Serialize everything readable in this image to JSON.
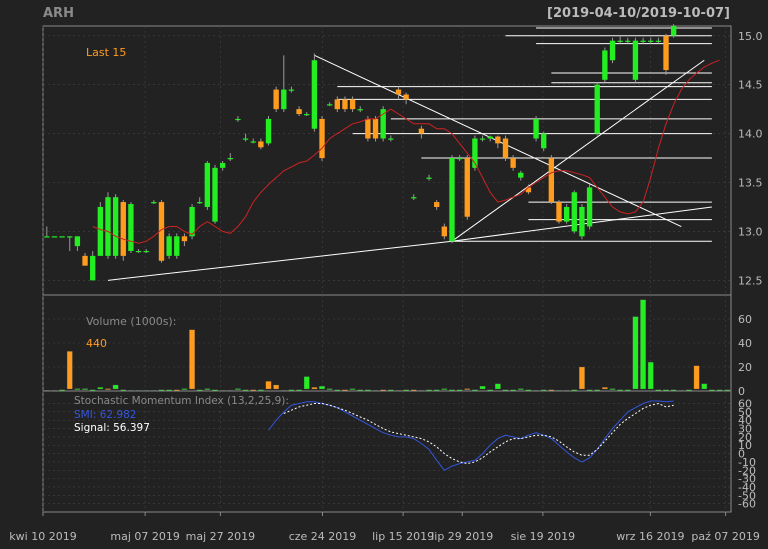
{
  "header": {
    "symbol": "ARH",
    "range": "[2019-04-10/2019-10-07]"
  },
  "colors": {
    "up": "#22ee22",
    "down": "#ff9c1e",
    "ma": "#cc2222",
    "smi": "#3355dd",
    "signal": "#ffffff",
    "panel": "#222222",
    "grid": "#444444"
  },
  "chart_data": [
    {
      "type": "candlestick",
      "panel": "price",
      "label": "Last 15",
      "ylim": [
        12.35,
        15.1
      ],
      "y_ticks": [
        12.5,
        13.0,
        13.5,
        14.0,
        14.5,
        15.0
      ],
      "y_tick_labels": [
        "12.5",
        "13.0",
        "13.5",
        "14.0",
        "14.5",
        "15.0"
      ],
      "candles": [
        {
          "o": 12.95,
          "c": 12.95,
          "h": 13.05,
          "l": 12.95
        },
        {
          "o": 12.95,
          "c": 12.95,
          "h": 12.95,
          "l": 12.95
        },
        {
          "o": 12.95,
          "c": 12.95,
          "h": 12.95,
          "l": 12.95
        },
        {
          "o": 12.95,
          "c": 12.95,
          "h": 12.95,
          "l": 12.8
        },
        {
          "o": 12.85,
          "c": 12.95,
          "h": 12.95,
          "l": 12.8
        },
        {
          "o": 12.75,
          "c": 12.65,
          "h": 12.78,
          "l": 12.65
        },
        {
          "o": 12.5,
          "c": 12.75,
          "h": 12.8,
          "l": 12.5
        },
        {
          "o": 12.75,
          "c": 13.25,
          "h": 13.3,
          "l": 12.75
        },
        {
          "o": 12.75,
          "c": 13.35,
          "h": 13.4,
          "l": 12.72
        },
        {
          "o": 12.75,
          "c": 13.35,
          "h": 13.38,
          "l": 12.72
        },
        {
          "o": 13.3,
          "c": 12.75,
          "h": 13.32,
          "l": 12.7
        },
        {
          "o": 12.8,
          "c": 13.28,
          "h": 13.3,
          "l": 12.78
        },
        {
          "o": 12.8,
          "c": 12.8,
          "h": 12.82,
          "l": 12.78
        },
        {
          "o": 12.8,
          "c": 12.8,
          "h": 12.82,
          "l": 12.78
        },
        {
          "o": 13.3,
          "c": 13.3,
          "h": 13.32,
          "l": 13.28
        },
        {
          "o": 13.3,
          "c": 12.7,
          "h": 13.32,
          "l": 12.68
        },
        {
          "o": 12.75,
          "c": 12.95,
          "h": 12.98,
          "l": 12.72
        },
        {
          "o": 12.75,
          "c": 12.95,
          "h": 12.98,
          "l": 12.72
        },
        {
          "o": 12.95,
          "c": 12.9,
          "h": 12.98,
          "l": 12.85
        },
        {
          "o": 12.95,
          "c": 13.25,
          "h": 13.28,
          "l": 12.92
        },
        {
          "o": 13.3,
          "c": 13.3,
          "h": 13.35,
          "l": 13.28
        },
        {
          "o": 13.25,
          "c": 13.7,
          "h": 13.72,
          "l": 13.22
        },
        {
          "o": 13.1,
          "c": 13.65,
          "h": 13.68,
          "l": 13.08
        },
        {
          "o": 13.65,
          "c": 13.7,
          "h": 13.72,
          "l": 13.62
        },
        {
          "o": 13.75,
          "c": 13.75,
          "h": 13.8,
          "l": 13.72
        },
        {
          "o": 14.15,
          "c": 14.15,
          "h": 14.18,
          "l": 14.12
        },
        {
          "o": 13.95,
          "c": 13.95,
          "h": 14.0,
          "l": 13.92
        },
        {
          "o": 13.92,
          "c": 13.92,
          "h": 13.95,
          "l": 13.9
        },
        {
          "o": 13.92,
          "c": 13.86,
          "h": 13.95,
          "l": 13.84
        },
        {
          "o": 13.9,
          "c": 14.15,
          "h": 14.18,
          "l": 13.88
        },
        {
          "o": 14.45,
          "c": 14.25,
          "h": 14.48,
          "l": 14.22
        },
        {
          "o": 14.25,
          "c": 14.45,
          "h": 14.8,
          "l": 14.22
        },
        {
          "o": 14.45,
          "c": 14.45,
          "h": 14.48,
          "l": 14.42
        },
        {
          "o": 14.25,
          "c": 14.2,
          "h": 14.28,
          "l": 14.18
        },
        {
          "o": 14.2,
          "c": 14.2,
          "h": 14.22,
          "l": 14.18
        },
        {
          "o": 14.05,
          "c": 14.75,
          "h": 14.82,
          "l": 14.02
        },
        {
          "o": 14.15,
          "c": 13.75,
          "h": 14.18,
          "l": 13.72
        },
        {
          "o": 14.3,
          "c": 14.3,
          "h": 14.32,
          "l": 14.28
        },
        {
          "o": 14.35,
          "c": 14.25,
          "h": 14.38,
          "l": 14.22
        },
        {
          "o": 14.35,
          "c": 14.25,
          "h": 14.38,
          "l": 14.22
        },
        {
          "o": 14.35,
          "c": 14.25,
          "h": 14.38,
          "l": 14.22
        },
        {
          "o": 14.25,
          "c": 14.25,
          "h": 14.28,
          "l": 14.22
        },
        {
          "o": 14.15,
          "c": 13.95,
          "h": 14.18,
          "l": 13.92
        },
        {
          "o": 14.15,
          "c": 13.95,
          "h": 14.18,
          "l": 13.92
        },
        {
          "o": 13.95,
          "c": 14.25,
          "h": 14.28,
          "l": 13.92
        },
        {
          "o": 13.95,
          "c": 13.95,
          "h": 13.98,
          "l": 13.92
        },
        {
          "o": 14.45,
          "c": 14.4,
          "h": 14.48,
          "l": 14.35
        },
        {
          "o": 14.4,
          "c": 14.35,
          "h": 14.42,
          "l": 14.3
        },
        {
          "o": 13.35,
          "c": 13.35,
          "h": 13.38,
          "l": 13.32
        },
        {
          "o": 14.05,
          "c": 14.0,
          "h": 14.08,
          "l": 13.95
        },
        {
          "o": 13.55,
          "c": 13.55,
          "h": 13.58,
          "l": 13.52
        },
        {
          "o": 13.3,
          "c": 13.25,
          "h": 13.32,
          "l": 13.22
        },
        {
          "o": 13.05,
          "c": 12.95,
          "h": 13.08,
          "l": 12.92
        },
        {
          "o": 12.9,
          "c": 13.75,
          "h": 13.78,
          "l": 12.88
        },
        {
          "o": 13.75,
          "c": 13.75,
          "h": 13.78,
          "l": 13.72
        },
        {
          "o": 13.75,
          "c": 13.15,
          "h": 13.78,
          "l": 13.12
        },
        {
          "o": 13.65,
          "c": 13.95,
          "h": 13.98,
          "l": 13.62
        },
        {
          "o": 13.95,
          "c": 13.95,
          "h": 13.98,
          "l": 13.92
        },
        {
          "o": 13.95,
          "c": 13.97,
          "h": 13.98,
          "l": 13.92
        },
        {
          "o": 13.97,
          "c": 13.9,
          "h": 13.98,
          "l": 13.85
        },
        {
          "o": 13.95,
          "c": 13.75,
          "h": 13.98,
          "l": 13.72
        },
        {
          "o": 13.75,
          "c": 13.65,
          "h": 13.78,
          "l": 13.62
        },
        {
          "o": 13.55,
          "c": 13.6,
          "h": 13.62,
          "l": 13.52
        },
        {
          "o": 13.45,
          "c": 13.4,
          "h": 13.48,
          "l": 13.38
        },
        {
          "o": 13.95,
          "c": 14.15,
          "h": 14.18,
          "l": 13.92
        },
        {
          "o": 13.85,
          "c": 14.0,
          "h": 14.02,
          "l": 13.82
        },
        {
          "o": 13.75,
          "c": 13.3,
          "h": 13.78,
          "l": 13.28
        },
        {
          "o": 13.3,
          "c": 13.1,
          "h": 13.32,
          "l": 13.08
        },
        {
          "o": 13.1,
          "c": 13.25,
          "h": 13.28,
          "l": 13.08
        },
        {
          "o": 13.0,
          "c": 13.4,
          "h": 13.42,
          "l": 12.98
        },
        {
          "o": 12.95,
          "c": 13.25,
          "h": 13.28,
          "l": 12.92
        },
        {
          "o": 13.05,
          "c": 13.45,
          "h": 13.48,
          "l": 13.02
        },
        {
          "o": 14.0,
          "c": 14.5,
          "h": 14.52,
          "l": 13.98
        },
        {
          "o": 14.55,
          "c": 14.85,
          "h": 14.88,
          "l": 14.52
        },
        {
          "o": 14.75,
          "c": 14.95,
          "h": 14.98,
          "l": 14.72
        },
        {
          "o": 14.95,
          "c": 14.95,
          "h": 15.0,
          "l": 14.92
        },
        {
          "o": 14.95,
          "c": 14.95,
          "h": 14.98,
          "l": 14.92
        },
        {
          "o": 14.55,
          "c": 14.95,
          "h": 14.98,
          "l": 14.52
        },
        {
          "o": 14.95,
          "c": 14.95,
          "h": 14.98,
          "l": 14.92
        },
        {
          "o": 14.95,
          "c": 14.95,
          "h": 14.98,
          "l": 14.92
        },
        {
          "o": 14.95,
          "c": 14.95,
          "h": 14.98,
          "l": 14.92
        },
        {
          "o": 15.0,
          "c": 14.65,
          "h": 15.02,
          "l": 14.6
        },
        {
          "o": 15.0,
          "c": 15.1,
          "h": 15.12,
          "l": 14.98
        }
      ],
      "ma_line": [
        13.05,
        13.02,
        13.0,
        12.95,
        12.92,
        12.9,
        12.88,
        12.9,
        12.95,
        13.02,
        13.05,
        13.05,
        13.0,
        12.97,
        13.05,
        13.1,
        13.05,
        13.0,
        12.98,
        13.05,
        13.15,
        13.3,
        13.4,
        13.48,
        13.55,
        13.62,
        13.66,
        13.7,
        13.72,
        13.78,
        13.85,
        13.95,
        14.0,
        14.05,
        14.1,
        14.12,
        14.15,
        14.15,
        14.2,
        14.25,
        14.2,
        14.15,
        14.1,
        14.1,
        14.1,
        14.05,
        14.05,
        14.0,
        13.9,
        13.8,
        13.7,
        13.55,
        13.4,
        13.3,
        13.32,
        13.35,
        13.38,
        13.45,
        13.5,
        13.55,
        13.6,
        13.62,
        13.62,
        13.6,
        13.58,
        13.55,
        13.45,
        13.35,
        13.25,
        13.2,
        13.18,
        13.2,
        13.3,
        13.55,
        13.85,
        14.1,
        14.3,
        14.45,
        14.55,
        14.62,
        14.68,
        14.72,
        14.75
      ],
      "trend_lines": [
        {
          "x0": 8,
          "y0": 12.5,
          "x1": 53,
          "y1": 12.9
        },
        {
          "x0": 53,
          "y0": 12.9,
          "x1": 86,
          "y1": 14.75
        },
        {
          "x0": 35,
          "y0": 14.8,
          "x1": 83,
          "y1": 13.05
        },
        {
          "x0": 53,
          "y0": 12.9,
          "x1": 87,
          "y1": 13.25
        }
      ],
      "support_levels": [
        {
          "x0": 64,
          "x1": 87,
          "y": 15.08
        },
        {
          "x0": 60,
          "x1": 87,
          "y": 15.0
        },
        {
          "x0": 64,
          "x1": 87,
          "y": 14.92
        },
        {
          "x0": 66,
          "x1": 87,
          "y": 14.62
        },
        {
          "x0": 66,
          "x1": 87,
          "y": 14.52
        },
        {
          "x0": 38,
          "x1": 87,
          "y": 14.48
        },
        {
          "x0": 38,
          "x1": 87,
          "y": 14.35
        },
        {
          "x0": 45,
          "x1": 87,
          "y": 14.15
        },
        {
          "x0": 40,
          "x1": 87,
          "y": 14.0
        },
        {
          "x0": 49,
          "x1": 87,
          "y": 13.75
        },
        {
          "x0": 63,
          "x1": 87,
          "y": 13.3
        },
        {
          "x0": 63,
          "x1": 87,
          "y": 13.12
        },
        {
          "x0": 53,
          "x1": 87,
          "y": 12.9
        }
      ]
    },
    {
      "type": "bar",
      "panel": "volume",
      "label": "Volume (1000s):",
      "last_value": "440",
      "ylim": [
        0,
        80
      ],
      "y_ticks": [
        0,
        20,
        40,
        60
      ],
      "y_tick_labels": [
        "0",
        "20",
        "40",
        "60"
      ],
      "values": [
        0.5,
        0.5,
        1,
        33,
        2,
        2,
        1,
        3,
        2,
        5,
        1,
        0.5,
        0.5,
        0.5,
        0.5,
        1,
        1,
        1,
        2,
        51,
        1,
        2,
        1,
        0.5,
        0.5,
        2,
        1,
        1,
        1,
        8,
        5,
        0.5,
        1,
        1,
        12,
        3,
        4,
        2,
        1,
        1,
        2,
        1,
        1,
        0.5,
        1,
        1,
        0.5,
        1,
        1,
        0.5,
        1,
        1,
        2,
        1,
        1,
        2,
        1,
        4,
        1,
        6,
        1,
        1,
        2,
        1,
        0.5,
        1,
        1,
        0.5,
        0.5,
        1,
        20,
        1,
        1,
        3,
        2,
        1,
        1,
        62,
        76,
        24,
        1,
        1,
        1,
        0.5,
        1,
        21,
        6,
        1,
        1,
        1
      ],
      "down": [
        false,
        false,
        false,
        true,
        false,
        false,
        false,
        false,
        true,
        false,
        false,
        false,
        false,
        false,
        false,
        false,
        false,
        true,
        false,
        true,
        false,
        false,
        false,
        false,
        false,
        false,
        false,
        true,
        false,
        true,
        true,
        false,
        false,
        false,
        false,
        true,
        false,
        false,
        false,
        true,
        false,
        false,
        false,
        false,
        true,
        false,
        false,
        false,
        true,
        false,
        false,
        false,
        false,
        false,
        false,
        true,
        false,
        false,
        false,
        false,
        false,
        false,
        false,
        false,
        false,
        false,
        true,
        false,
        false,
        false,
        true,
        false,
        false,
        true,
        false,
        false,
        false,
        false,
        false,
        false,
        false,
        false,
        false,
        false,
        false,
        true,
        false,
        false,
        false,
        false
      ]
    },
    {
      "type": "line",
      "panel": "oscillator",
      "label": "Stochastic Momentum Index (13,2,25,9):",
      "smi_label": "SMI: 62.982",
      "signal_label": "Signal: 56.397",
      "ylim": [
        -70,
        75
      ],
      "y_ticks": [
        -60,
        -50,
        -40,
        -30,
        -20,
        -10,
        0,
        10,
        20,
        30,
        40,
        50,
        60
      ],
      "y_tick_labels": [
        "-60",
        "-50",
        "-40",
        "-30",
        "-20",
        "-10",
        "0",
        "10",
        "20",
        "30",
        "40",
        "50",
        "60"
      ],
      "smi": [
        null,
        null,
        null,
        null,
        null,
        null,
        null,
        null,
        null,
        null,
        null,
        null,
        null,
        null,
        null,
        null,
        null,
        null,
        null,
        null,
        null,
        null,
        null,
        null,
        28,
        40,
        50,
        58,
        60,
        62,
        62,
        60,
        58,
        55,
        50,
        45,
        40,
        35,
        30,
        25,
        22,
        20,
        20,
        18,
        12,
        5,
        -8,
        -20,
        -15,
        -12,
        -10,
        -8,
        0,
        10,
        18,
        22,
        20,
        18,
        22,
        25,
        22,
        18,
        10,
        2,
        -5,
        -10,
        -5,
        5,
        18,
        30,
        40,
        50,
        55,
        60,
        63,
        63,
        62,
        63
      ],
      "signal": [
        null,
        null,
        null,
        null,
        null,
        null,
        null,
        null,
        null,
        null,
        null,
        null,
        null,
        null,
        null,
        null,
        null,
        null,
        null,
        null,
        null,
        null,
        null,
        null,
        null,
        null,
        48,
        52,
        56,
        58,
        60,
        60,
        58,
        55,
        52,
        48,
        44,
        40,
        35,
        30,
        26,
        24,
        22,
        20,
        18,
        14,
        8,
        0,
        -6,
        -10,
        -12,
        -10,
        -5,
        2,
        8,
        14,
        18,
        18,
        20,
        22,
        22,
        20,
        15,
        8,
        2,
        -2,
        -2,
        5,
        15,
        25,
        35,
        42,
        48,
        54,
        58,
        60,
        56,
        58
      ]
    }
  ],
  "x_axis": {
    "labels": [
      "kwi 10 2019",
      "maj 07 2019",
      "maj 27 2019",
      "cze 24 2019",
      "lip 15 2019",
      "lip 29 2019",
      "sie 19 2019",
      "wrz 16 2019",
      "paź 07 2019"
    ],
    "positions": [
      0,
      19,
      33,
      52,
      67,
      78,
      93,
      113,
      127
    ]
  }
}
